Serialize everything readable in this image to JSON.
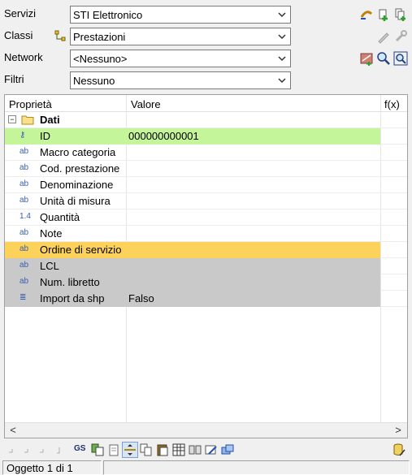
{
  "filters": {
    "servizi": {
      "label": "Servizi",
      "value": "STI Elettronico"
    },
    "classi": {
      "label": "Classi",
      "value": "Prestazioni"
    },
    "network": {
      "label": "Network",
      "value": "<Nessuno>"
    },
    "filtri": {
      "label": "Filtri",
      "value": "Nessuno"
    }
  },
  "grid": {
    "columns": {
      "property": "Proprietà",
      "value": "Valore",
      "fx": "f(x)"
    },
    "group": {
      "label": "Dati",
      "expander": "−"
    },
    "rows": [
      {
        "name": "ID",
        "value": "000000000001",
        "icon": "key-icon",
        "icon_text": "⚷",
        "highlight": "#c5f59a"
      },
      {
        "name": "Macro categoria",
        "value": "",
        "icon": "text-type-icon",
        "icon_text": "ab",
        "highlight": ""
      },
      {
        "name": "Cod. prestazione",
        "value": "",
        "icon": "text-type-icon",
        "icon_text": "ab",
        "highlight": ""
      },
      {
        "name": "Denominazione",
        "value": "",
        "icon": "text-type-icon",
        "icon_text": "ab",
        "highlight": ""
      },
      {
        "name": "Unità di misura",
        "value": "",
        "icon": "text-type-icon",
        "icon_text": "ab",
        "highlight": ""
      },
      {
        "name": "Quantità",
        "value": "",
        "icon": "number-type-icon",
        "icon_text": "1.4",
        "highlight": ""
      },
      {
        "name": "Note",
        "value": "",
        "icon": "text-type-icon",
        "icon_text": "ab",
        "highlight": ""
      },
      {
        "name": "Ordine di servizio",
        "value": "",
        "icon": "text-type-icon",
        "icon_text": "ab",
        "highlight": "#fcd25a"
      },
      {
        "name": "LCL",
        "value": "",
        "icon": "text-type-icon",
        "icon_text": "ab",
        "highlight": "#c9c9c9"
      },
      {
        "name": "Num. libretto",
        "value": "",
        "icon": "text-type-icon",
        "icon_text": "ab",
        "highlight": "#c9c9c9"
      },
      {
        "name": "Import da shp",
        "value": "Falso",
        "icon": "list-type-icon",
        "icon_text": "≣",
        "highlight": "#c9c9c9"
      }
    ]
  },
  "toolbar": {
    "gs_label": "GS"
  },
  "status": {
    "object_counter": "Oggetto 1 di 1",
    "panel2": ""
  },
  "scrollbar": {
    "left": "<",
    "right": ">"
  }
}
